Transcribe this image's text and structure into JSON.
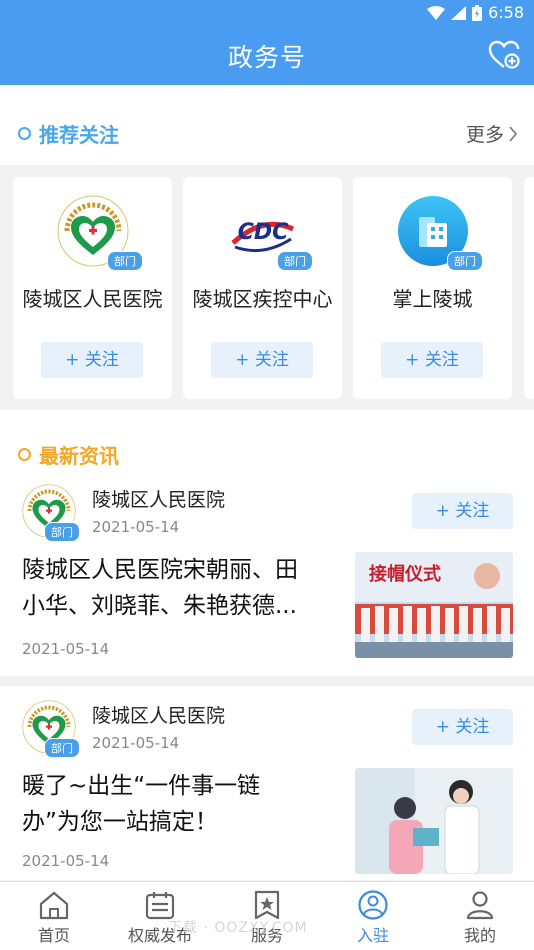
{
  "status_bar": {
    "time": "6:58"
  },
  "header": {
    "title": "政务号"
  },
  "recommend": {
    "title": "推荐关注",
    "more_label": "更多",
    "badge": "部门",
    "cards": [
      {
        "name": "陵城区人民医院",
        "follow_label": "+ 关注"
      },
      {
        "name": "陵城区疾控中心",
        "follow_label": "+ 关注"
      },
      {
        "name": "掌上陵城",
        "follow_label": "+ 关注"
      }
    ]
  },
  "latest": {
    "title": "最新资讯",
    "items": [
      {
        "author": "陵城区人民医院",
        "date_top": "2021-05-14",
        "badge": "部门",
        "follow_label": "+ 关注",
        "headline_line1": "陵城区人民医院宋朝丽、田",
        "headline_line2": "小华、刘晓菲、朱艳获德...",
        "thumb_text": "接帽仪式",
        "date_bottom": "2021-05-14"
      },
      {
        "author": "陵城区人民医院",
        "date_top": "2021-05-14",
        "badge": "部门",
        "follow_label": "+ 关注",
        "headline_line1": "暖了~出生“一件事一链",
        "headline_line2": "办”为您一站搞定！",
        "date_bottom": "2021-05-14"
      }
    ]
  },
  "tabs": [
    {
      "label": "首页",
      "icon": "home-icon"
    },
    {
      "label": "权威发布",
      "icon": "list-icon"
    },
    {
      "label": "服务",
      "icon": "bookmark-star-icon"
    },
    {
      "label": "入驻",
      "icon": "user-circle-icon",
      "active": true
    },
    {
      "label": "我的",
      "icon": "person-icon"
    }
  ],
  "watermark": "下载 · OOZXY.COM",
  "colors": {
    "primary": "#4a9cf0",
    "accent_blue": "#3b8be0",
    "orange": "#f5a623",
    "follow_bg": "#e6f1fc"
  }
}
